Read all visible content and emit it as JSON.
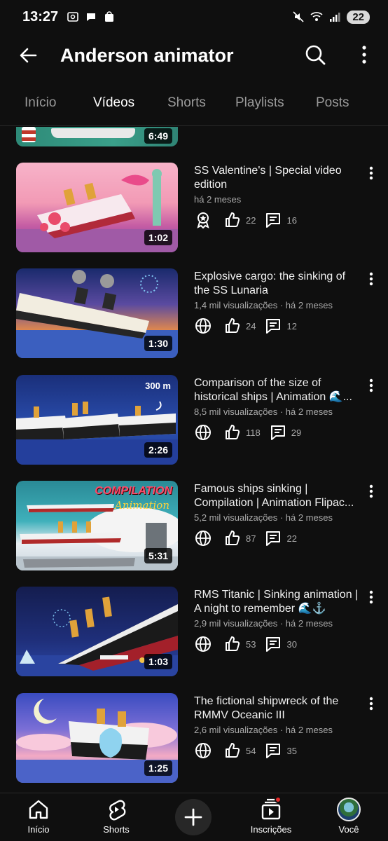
{
  "status_bar": {
    "time": "13:27",
    "battery": "22"
  },
  "header": {
    "title": "Anderson animator"
  },
  "tabs": [
    {
      "label": "Início"
    },
    {
      "label": "Vídeos"
    },
    {
      "label": "Shorts"
    },
    {
      "label": "Playlists"
    },
    {
      "label": "Posts"
    }
  ],
  "partial_video": {
    "duration": "6:49"
  },
  "videos": [
    {
      "title": "SS Valentine's | Special video edition",
      "meta": "há 2 meses",
      "duration": "1:02",
      "visibility_icon": "badge-icon",
      "likes": "22",
      "comments": "16"
    },
    {
      "title": "Explosive cargo: the sinking of the SS Lunaria",
      "meta": "1,4 mil visualizações · há 2 meses",
      "duration": "1:30",
      "visibility_icon": "globe-icon",
      "likes": "24",
      "comments": "12"
    },
    {
      "title": "Comparison of the size of historical ships | Animation 🌊...",
      "meta": "8,5 mil visualizações · há 2 meses",
      "duration": "2:26",
      "thumb_text": "300 m",
      "visibility_icon": "globe-icon",
      "likes": "118",
      "comments": "29"
    },
    {
      "title": "Famous ships sinking | Compilation | Animation Flipac...",
      "meta": "5,2 mil visualizações · há 2 meses",
      "duration": "5:31",
      "thumb_text_1": "COMPILATION",
      "thumb_text_2": "Animation",
      "visibility_icon": "globe-icon",
      "likes": "87",
      "comments": "22"
    },
    {
      "title": "RMS Titanic | Sinking animation | A night to remember 🌊⚓",
      "meta": "2,9 mil visualizações · há 2 meses",
      "duration": "1:03",
      "visibility_icon": "globe-icon",
      "likes": "53",
      "comments": "30"
    },
    {
      "title": "The fictional shipwreck of the RMMV Oceanic III",
      "meta": "2,6 mil visualizações · há 2 meses",
      "duration": "1:25",
      "visibility_icon": "globe-icon",
      "likes": "54",
      "comments": "35"
    }
  ],
  "bottom_nav": [
    {
      "label": "Início",
      "icon": "home-icon"
    },
    {
      "label": "Shorts",
      "icon": "shorts-icon"
    },
    {
      "label": "",
      "icon": "plus-icon"
    },
    {
      "label": "Inscrições",
      "icon": "subscriptions-icon"
    },
    {
      "label": "Você",
      "icon": "avatar"
    }
  ],
  "colors": {
    "background": "#0f0f0f",
    "text_primary": "#f1f1f1",
    "text_secondary": "#aaaaaa",
    "notification": "#e32b2b"
  }
}
